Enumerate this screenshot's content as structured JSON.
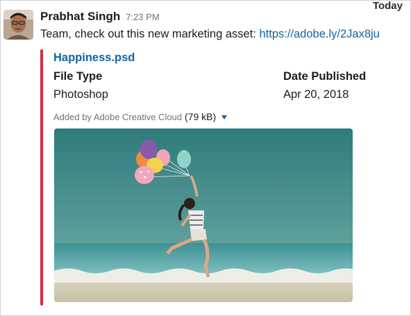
{
  "day_divider": "Today",
  "message": {
    "sender": "Prabhat Singh",
    "time": "7:23 PM",
    "text": "Team, check out this new marketing asset: ",
    "link": "https://adobe.ly/2Jax8ju"
  },
  "attachment": {
    "title": "Happiness.psd",
    "fields": [
      {
        "label": "File Type",
        "value": "Photoshop"
      },
      {
        "label": "Date Published",
        "value": "Apr 20, 2018"
      }
    ],
    "footer_source": "Added by Adobe Creative Cloud",
    "footer_size": "(79 kB)",
    "accent_color": "#d72b3f"
  },
  "icons": {
    "caret": "caret-down-icon"
  }
}
